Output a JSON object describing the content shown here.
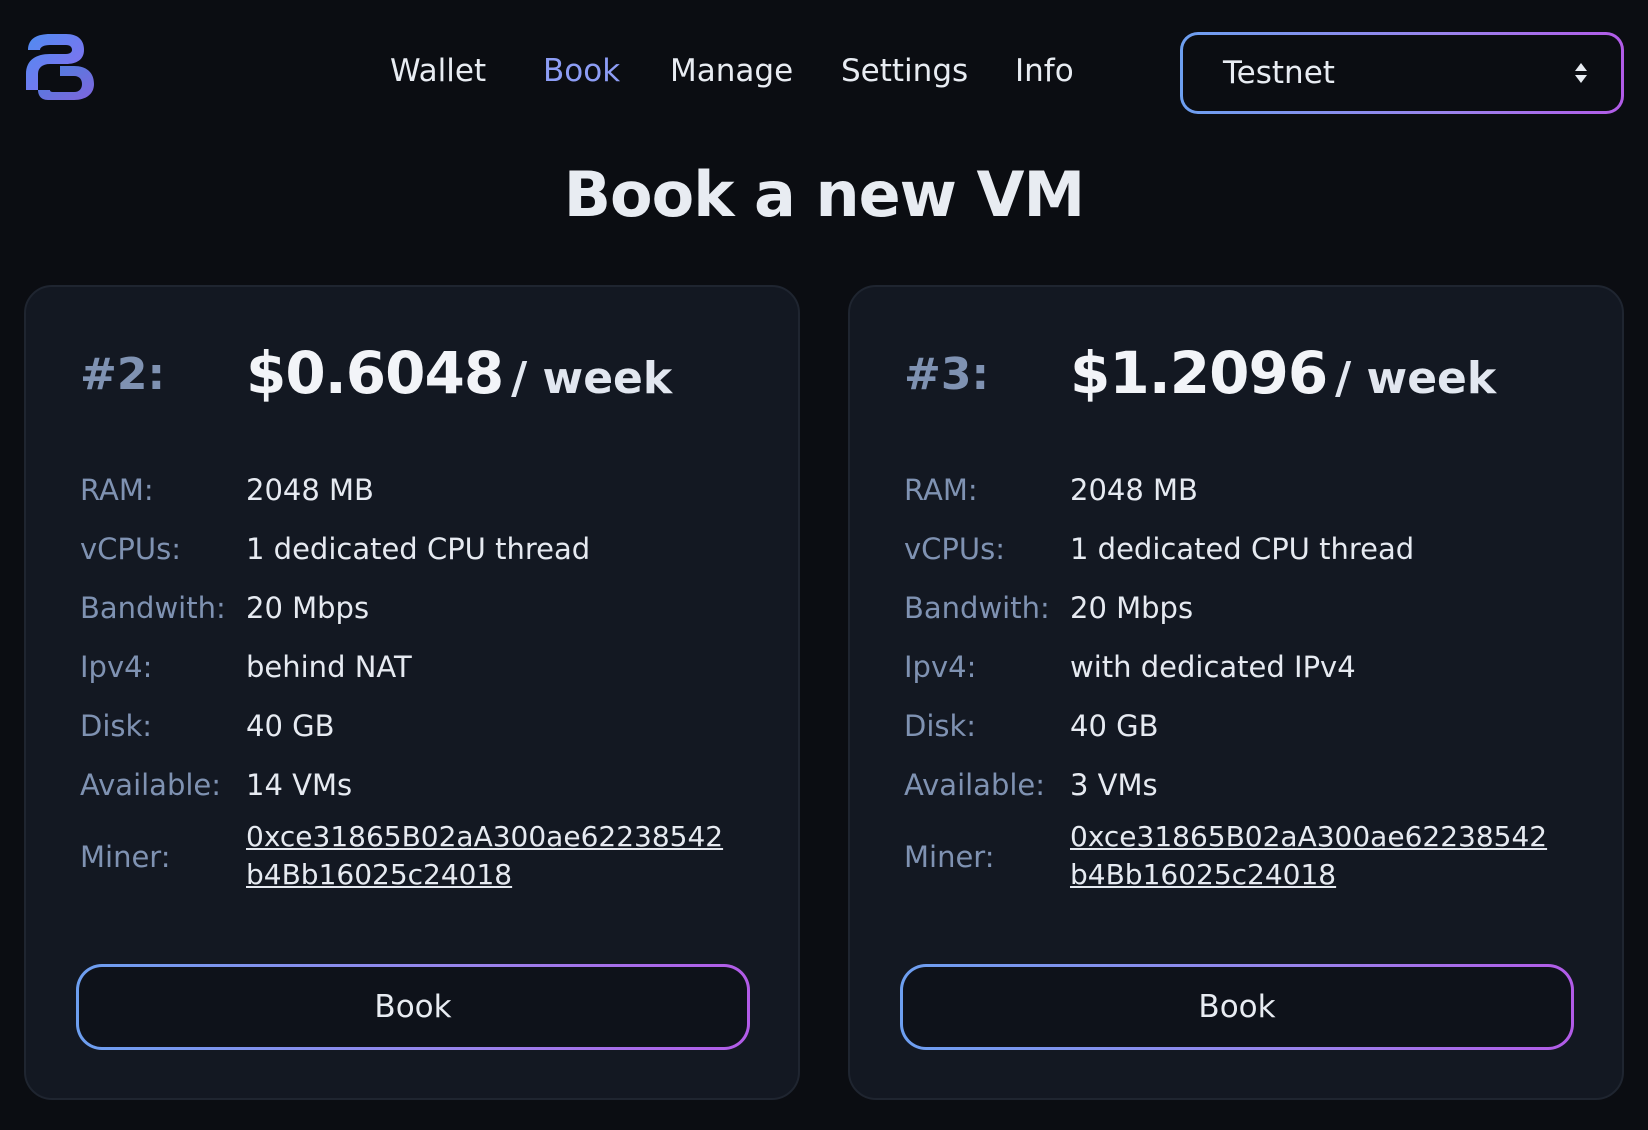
{
  "header": {
    "nav": [
      {
        "label": "Wallet",
        "active": false
      },
      {
        "label": "Book",
        "active": true
      },
      {
        "label": "Manage",
        "active": false
      },
      {
        "label": "Settings",
        "active": false
      },
      {
        "label": "Info",
        "active": false
      }
    ],
    "network_select": {
      "value": "Testnet",
      "icon": "sort-arrows-icon"
    },
    "logo_icon": "brand-logo-icon"
  },
  "page_title": "Book a new VM",
  "colors": {
    "background": "#0b0d12",
    "card": "#131822",
    "accent_start": "#6d9ff0",
    "accent_end": "#b25be8",
    "nav_active": "#8d9df5",
    "label_muted": "#7f92b2"
  },
  "offers": [
    {
      "id": "#2:",
      "price": "$0.6048",
      "period": "/ week",
      "specs": {
        "ram_label": "RAM:",
        "ram": "2048 MB",
        "vcpu_label": "vCPUs:",
        "vcpu": "1 dedicated CPU thread",
        "bandwidth_label": "Bandwith:",
        "bandwidth": "20 Mbps",
        "ipv4_label": "Ipv4:",
        "ipv4": "behind NAT",
        "disk_label": "Disk:",
        "disk": "40 GB",
        "available_label": "Available:",
        "available": "14 VMs",
        "miner_label": "Miner:",
        "miner": "0xce31865B02aA300ae62238542b4Bb16025c24018"
      },
      "button": "Book"
    },
    {
      "id": "#3:",
      "price": "$1.2096",
      "period": "/ week",
      "specs": {
        "ram_label": "RAM:",
        "ram": "2048 MB",
        "vcpu_label": "vCPUs:",
        "vcpu": "1 dedicated CPU thread",
        "bandwidth_label": "Bandwith:",
        "bandwidth": "20 Mbps",
        "ipv4_label": "Ipv4:",
        "ipv4": "with dedicated IPv4",
        "disk_label": "Disk:",
        "disk": "40 GB",
        "available_label": "Available:",
        "available": "3 VMs",
        "miner_label": "Miner:",
        "miner": "0xce31865B02aA300ae62238542b4Bb16025c24018"
      },
      "button": "Book"
    }
  ]
}
